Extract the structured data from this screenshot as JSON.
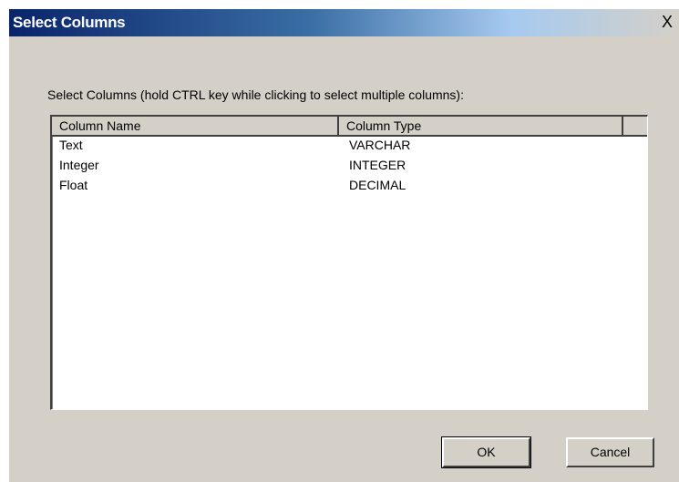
{
  "window": {
    "title": "Select Columns",
    "close_glyph": "X"
  },
  "instruction": "Select Columns (hold CTRL key while clicking to select multiple columns):",
  "list": {
    "headers": [
      "Column Name",
      "Column Type"
    ],
    "rows": [
      {
        "name": "Text",
        "type": "VARCHAR"
      },
      {
        "name": "Integer",
        "type": "INTEGER"
      },
      {
        "name": "Float",
        "type": "DECIMAL"
      }
    ]
  },
  "buttons": {
    "ok": "OK",
    "cancel": "Cancel"
  },
  "colors": {
    "title_start": "#0a246a",
    "title_end": "#d4d0c8",
    "dialog_bg": "#d4d0c8",
    "list_bg": "#ffffff"
  }
}
